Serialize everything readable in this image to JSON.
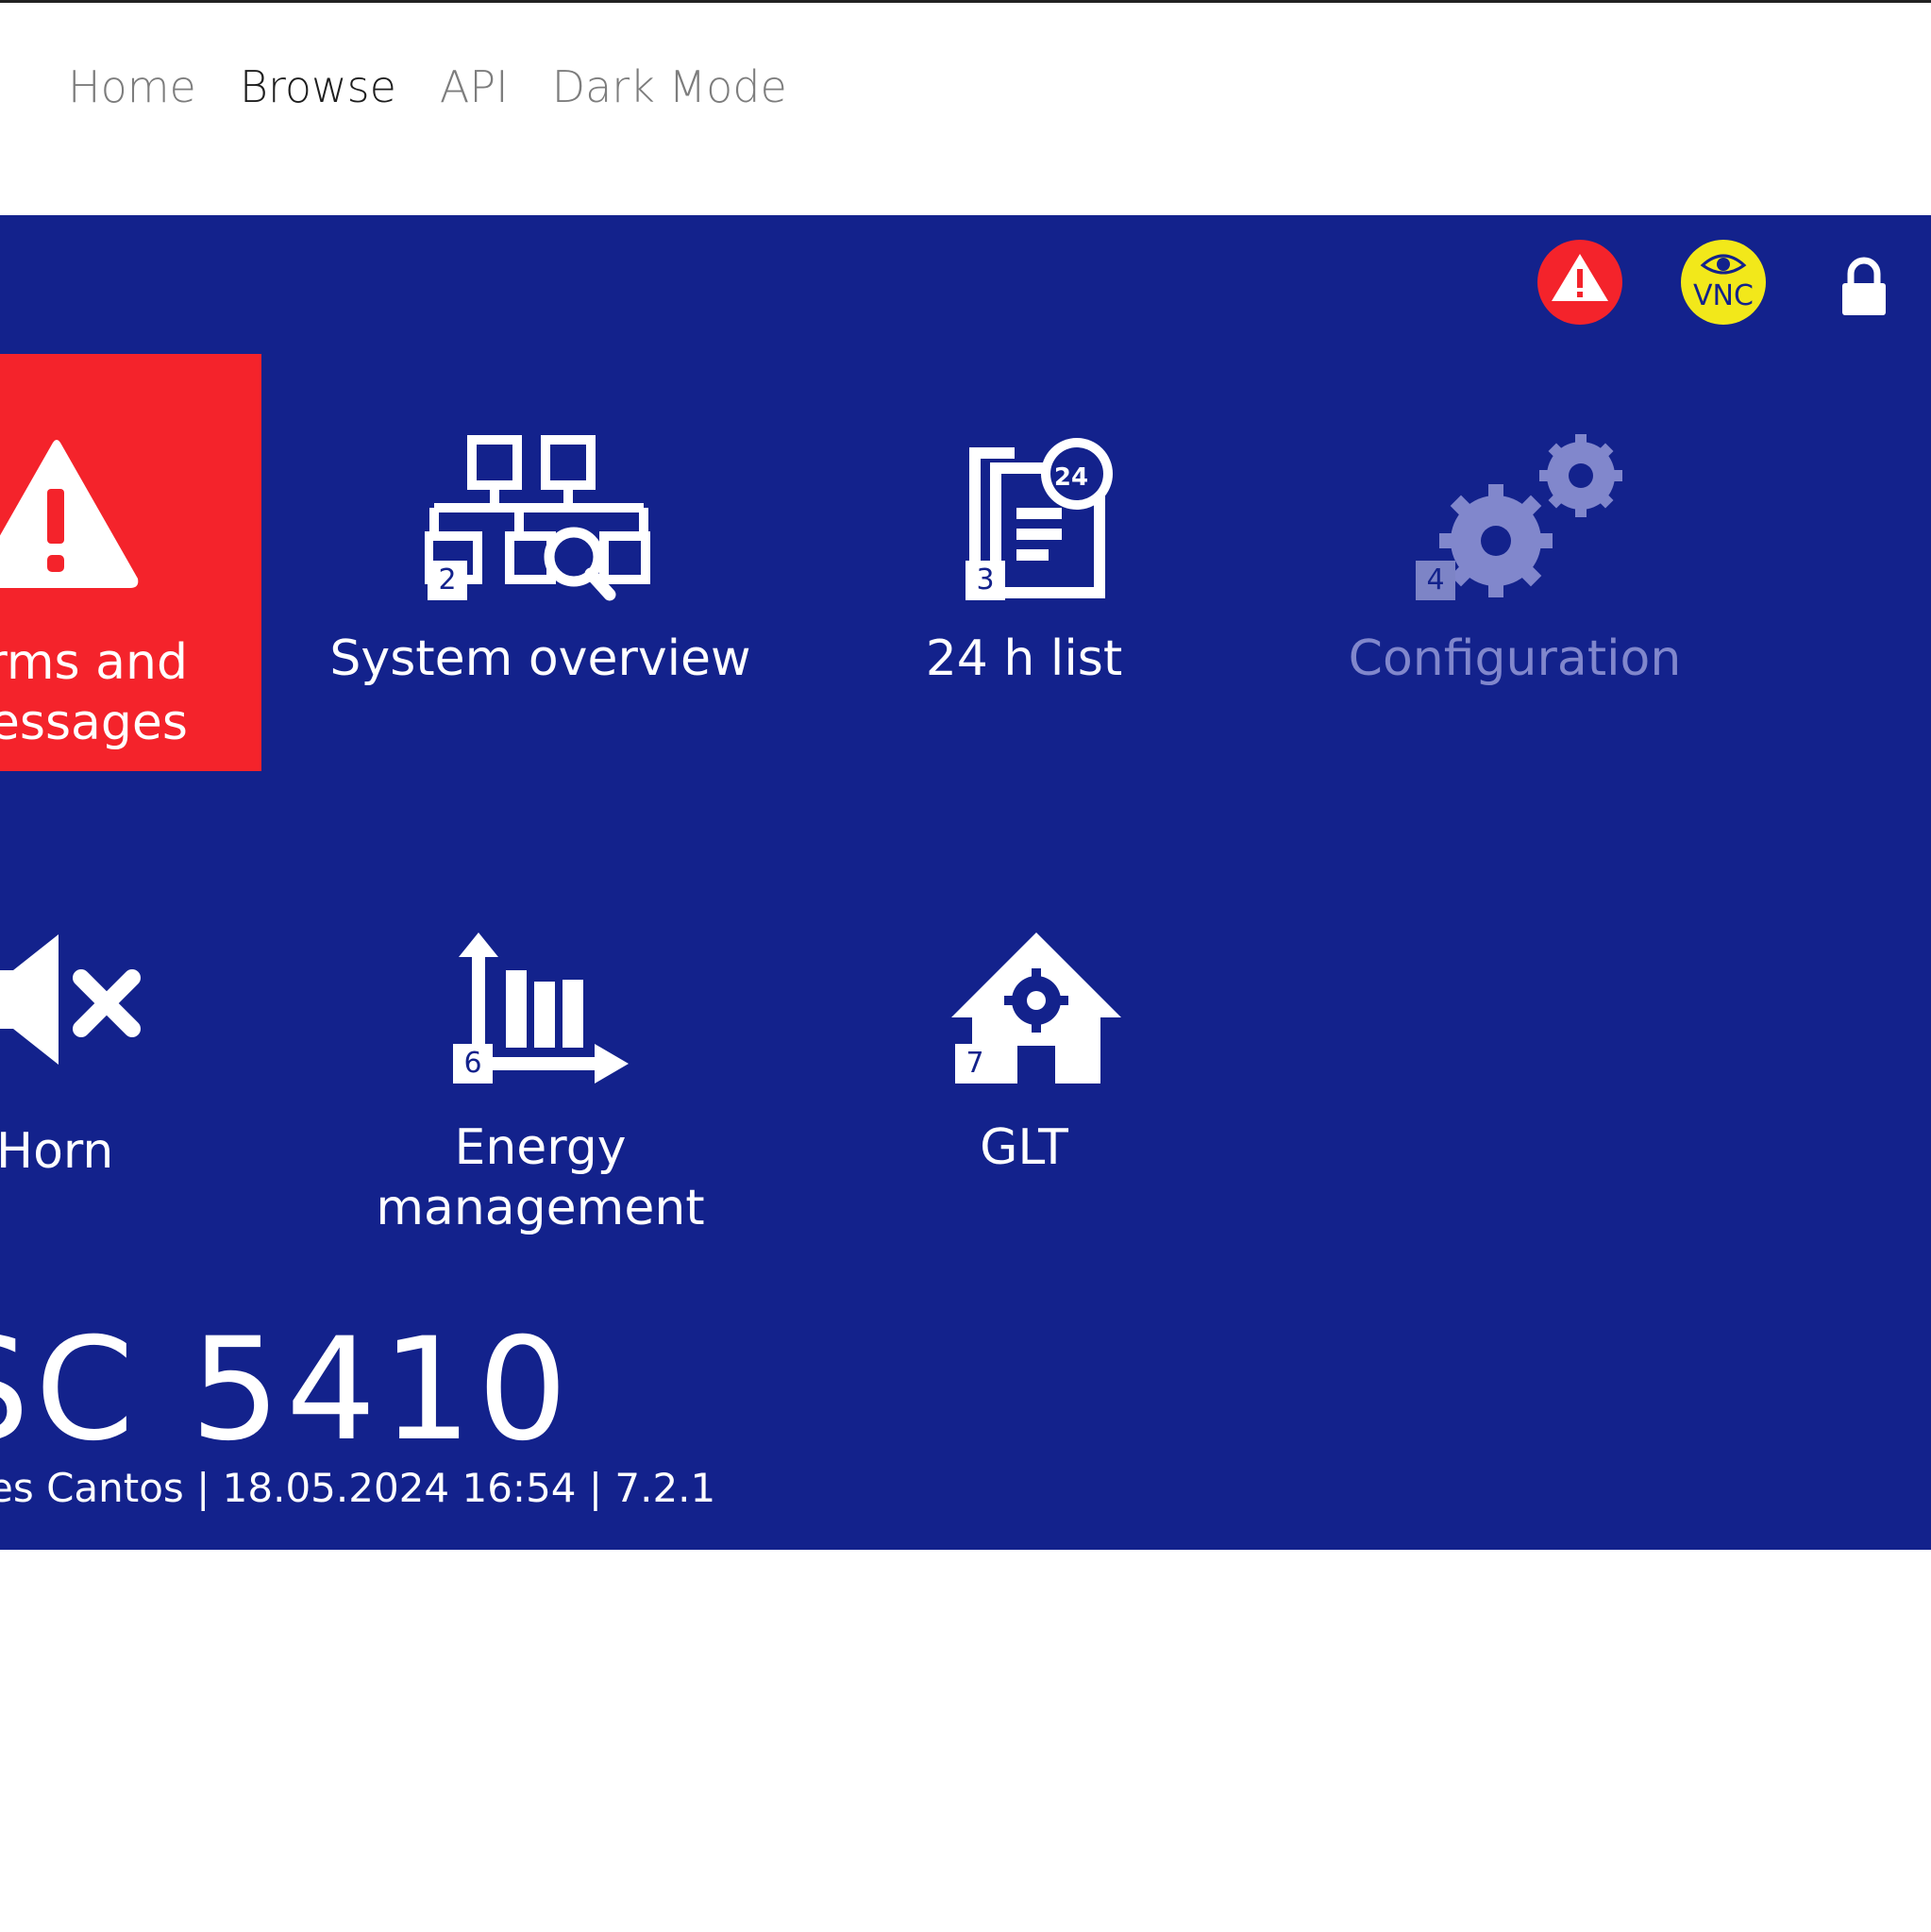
{
  "nav": {
    "items": [
      {
        "label": "Home",
        "active": false
      },
      {
        "label": "Browse",
        "active": true
      },
      {
        "label": "API",
        "active": false
      },
      {
        "label": "Dark Mode",
        "active": false
      }
    ]
  },
  "status_icons": {
    "alarm": "warning-icon",
    "vnc": {
      "label": "VNC",
      "icon": "vnc-eye-icon"
    },
    "lock": "lock-icon"
  },
  "tiles": {
    "alarms": {
      "label_line1": "rms and",
      "label_line2": "essages",
      "icon": "warning-triangle-icon"
    },
    "system_overview": {
      "label": "System overview",
      "number": "2",
      "icon": "network-search-icon"
    },
    "list24": {
      "label": "24 h list",
      "number": "3",
      "badge_text": "24",
      "icon": "document-clock-icon"
    },
    "configuration": {
      "label": "Configuration",
      "number": "4",
      "icon": "gears-icon",
      "enabled": false
    },
    "horn": {
      "label": "Horn",
      "icon": "speaker-mute-icon"
    },
    "energy": {
      "label_line1": "Energy",
      "label_line2": "management",
      "number": "6",
      "icon": "bar-chart-arrow-icon"
    },
    "glt": {
      "label": "GLT",
      "number": "7",
      "icon": "house-gear-icon"
    }
  },
  "footer": {
    "model": "SC 5410",
    "info": "es Cantos | 18.05.2024 16:54 | 7.2.1"
  },
  "colors": {
    "panel": "#13228c",
    "alarm_tile": "#f4232b",
    "vnc_yellow": "#f2e81a",
    "disabled": "#8187cc"
  }
}
